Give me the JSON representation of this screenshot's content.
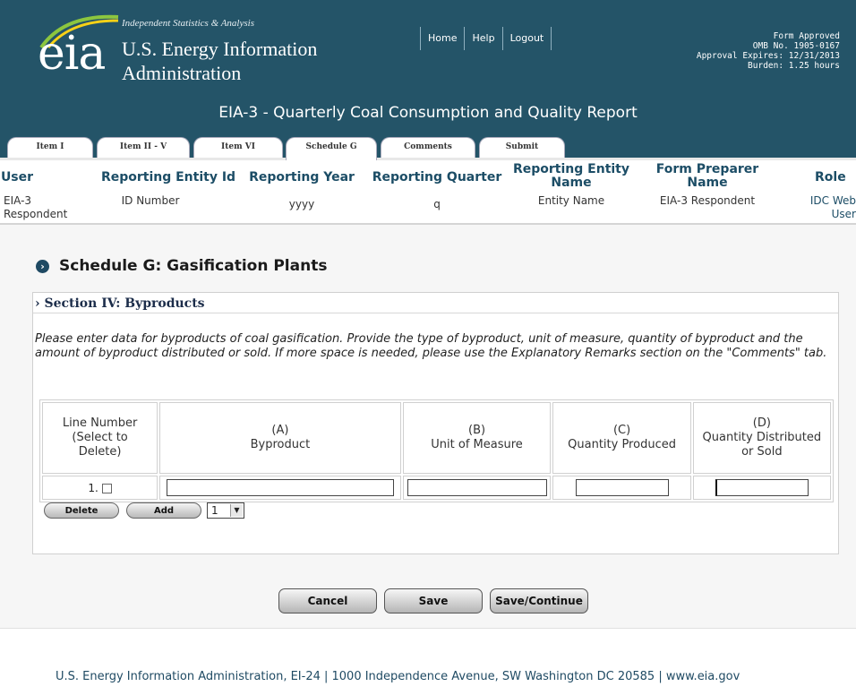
{
  "header": {
    "logo_text": "eia",
    "tagline": "Independent Statistics & Analysis",
    "agency_line1": "U.S. Energy Information",
    "agency_line2": "Administration",
    "nav": [
      "Home",
      "Help",
      "Logout"
    ],
    "approval": [
      "Form Approved",
      "OMB No. 1905-0167",
      "Approval Expires: 12/31/2013",
      "Burden: 1.25 hours"
    ],
    "form_title": "EIA-3 - Quarterly Coal Consumption and Quality Report"
  },
  "tabs": [
    {
      "label": "Item I",
      "active": false
    },
    {
      "label": "Item II - V",
      "active": false
    },
    {
      "label": "Item VI",
      "active": false
    },
    {
      "label": "Schedule G",
      "active": true
    },
    {
      "label": "Comments",
      "active": false
    },
    {
      "label": "Submit",
      "active": false
    }
  ],
  "info": {
    "headers": [
      "User",
      "Reporting Entity Id",
      "Reporting Year",
      "Reporting Quarter",
      "Reporting Entity Name",
      "Form Preparer Name",
      "Role"
    ],
    "values": [
      "EIA-3 Respondent",
      "ID Number",
      "yyyy",
      "q",
      "Entity Name",
      "EIA-3 Respondent",
      "IDC Web User"
    ]
  },
  "schedule_title": "Schedule G: Gasification Plants",
  "section": {
    "title": "Section IV: Byproducts",
    "instructions": "Please enter data for byproducts of coal gasification. Provide the type of byproduct, unit of measure, quantity of byproduct and the amount of byproduct distributed or sold. If more space is needed, please use the Explanatory Remarks section on the \"Comments\" tab.",
    "columns": [
      {
        "line1": "",
        "line2": "Line Number (Select to Delete)"
      },
      {
        "line1": "(A)",
        "line2": "Byproduct"
      },
      {
        "line1": "(B)",
        "line2": "Unit of Measure"
      },
      {
        "line1": "(C)",
        "line2": "Quantity Produced"
      },
      {
        "line1": "(D)",
        "line2": "Quantity Distributed or Sold"
      }
    ],
    "rows": [
      {
        "line": "1.",
        "byproduct": "",
        "unit": "",
        "produced": "",
        "distributed": ""
      }
    ],
    "delete_label": "Delete",
    "add_label": "Add",
    "add_count": "1"
  },
  "actions": {
    "cancel": "Cancel",
    "save": "Save",
    "save_continue": "Save/Continue"
  },
  "footer": "U.S. Energy Information Administration, EI-24 | 1000 Independence Avenue, SW Washington DC 20585  | www.eia.gov",
  "colors": {
    "header_bg": "#245468",
    "heading_text": "#1c4d66",
    "page_bg": "#f6f6f6"
  }
}
